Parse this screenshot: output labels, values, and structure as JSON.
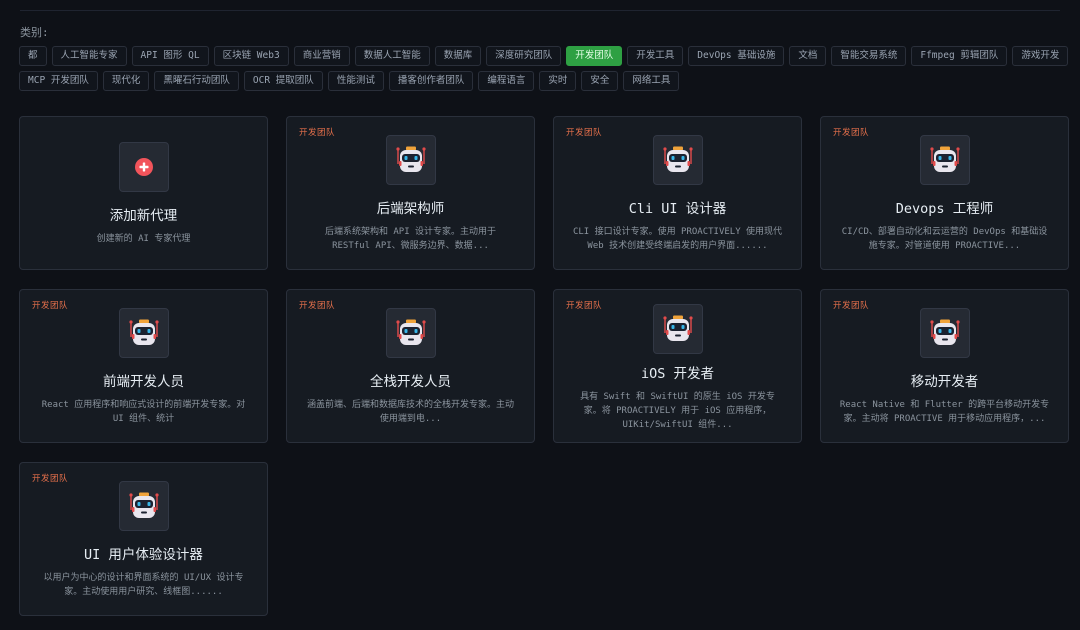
{
  "category_label": "类别:",
  "tags": [
    {
      "label": "都",
      "active": false
    },
    {
      "label": "人工智能专家",
      "active": false
    },
    {
      "label": "API 图形 QL",
      "active": false
    },
    {
      "label": "区块链 Web3",
      "active": false
    },
    {
      "label": "商业营销",
      "active": false
    },
    {
      "label": "数据人工智能",
      "active": false
    },
    {
      "label": "数据库",
      "active": false
    },
    {
      "label": "深度研究团队",
      "active": false
    },
    {
      "label": "开发团队",
      "active": true
    },
    {
      "label": "开发工具",
      "active": false
    },
    {
      "label": "DevOps 基础设施",
      "active": false
    },
    {
      "label": "文档",
      "active": false
    },
    {
      "label": "智能交易系统",
      "active": false
    },
    {
      "label": "Ffmpeg 剪辑团队",
      "active": false
    },
    {
      "label": "游戏开发",
      "active": false
    },
    {
      "label": "MCP 开发团队",
      "active": false
    },
    {
      "label": "现代化",
      "active": false
    },
    {
      "label": "黑曜石行动团队",
      "active": false
    },
    {
      "label": "OCR 提取团队",
      "active": false
    },
    {
      "label": "性能测试",
      "active": false
    },
    {
      "label": "播客创作者团队",
      "active": false
    },
    {
      "label": "编程语言",
      "active": false
    },
    {
      "label": "实时",
      "active": false
    },
    {
      "label": "安全",
      "active": false
    },
    {
      "label": "网络工具",
      "active": false
    }
  ],
  "add_card": {
    "title": "添加新代理",
    "desc": "创建新的 AI 专家代理",
    "icon": "plus-circle-icon"
  },
  "agents": [
    {
      "badge": "开发团队",
      "title": "后端架构师",
      "desc": "后端系统架构和 API 设计专家。主动用于 RESTful API、微服务边界、数据...",
      "icon": "robot-icon"
    },
    {
      "badge": "开发团队",
      "title": "Cli UI 设计器",
      "desc": "CLI 接口设计专家。使用 PROACTIVELY 使用现代 Web 技术创建受终端启发的用户界面......",
      "icon": "robot-icon"
    },
    {
      "badge": "开发团队",
      "title": "Devops 工程师",
      "desc": "CI/CD、部署自动化和云运营的 DevOps 和基础设施专家。对管道使用 PROACTIVE...",
      "icon": "robot-icon"
    },
    {
      "badge": "开发团队",
      "title": "前端开发人员",
      "desc": "React 应用程序和响应式设计的前端开发专家。对 UI 组件、统计",
      "icon": "robot-icon"
    },
    {
      "badge": "开发团队",
      "title": "全栈开发人员",
      "desc": "涵盖前端、后端和数据库技术的全栈开发专家。主动使用端到电...",
      "icon": "robot-icon"
    },
    {
      "badge": "开发团队",
      "title": "iOS 开发者",
      "desc": "具有 Swift 和 SwiftUI 的原生 iOS 开发专家。将 PROACTIVELY 用于 iOS 应用程序，UIKit/SwiftUI 组件...",
      "icon": "robot-icon"
    },
    {
      "badge": "开发团队",
      "title": "移动开发者",
      "desc": "React Native 和 Flutter 的跨平台移动开发专家。主动将 PROACTIVE 用于移动应用程序，...",
      "icon": "robot-icon"
    },
    {
      "badge": "开发团队",
      "title": "UI 用户体验设计器",
      "desc": "以用户为中心的设计和界面系统的 UI/UX 设计专家。主动使用用户研究、线框图......",
      "icon": "robot-icon"
    }
  ],
  "colors": {
    "active_tag": "#2ea043",
    "badge": "#e5704b",
    "plus": "#f2545b",
    "robot_accent": "#e24b4b",
    "robot_eye": "#38b6e8"
  }
}
